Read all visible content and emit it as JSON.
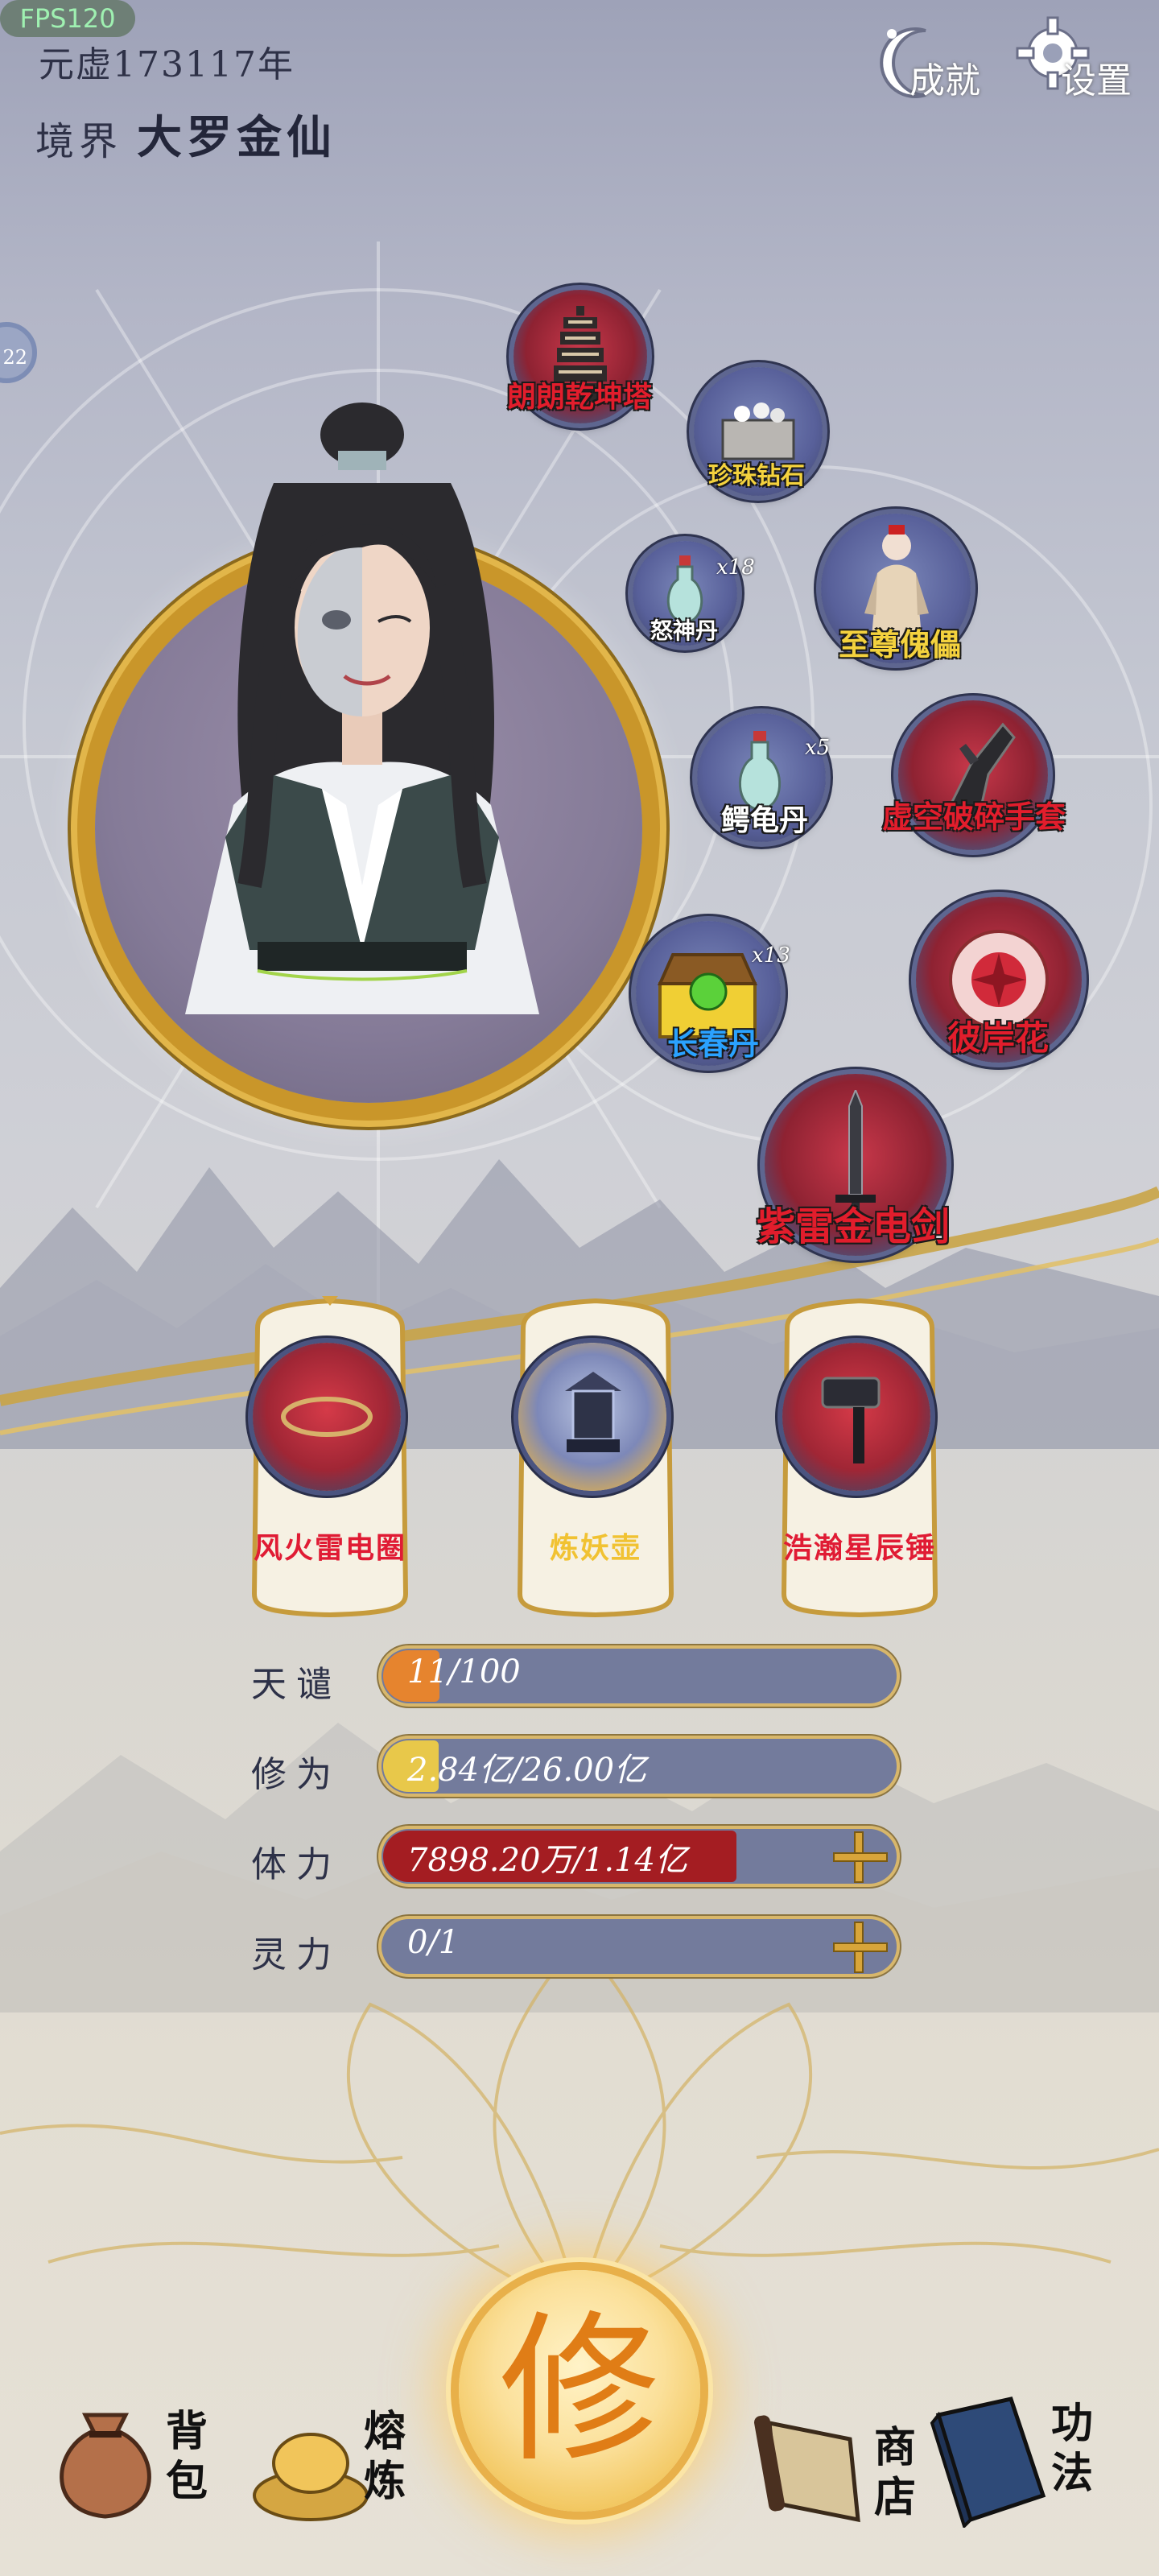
{
  "header": {
    "era": "元虚173117年",
    "realm_label": "境界",
    "realm_value": "大罗金仙",
    "fps": "FPS120",
    "achievements_label": "成就",
    "settings_label": "设置",
    "side_badge": "22"
  },
  "items": [
    {
      "name": "朗朗乾坤塔",
      "color": "red"
    },
    {
      "name": "珍珠钻石",
      "color": "gold"
    },
    {
      "name": "怒神丹",
      "color": "white",
      "count": "x18"
    },
    {
      "name": "至尊傀儡",
      "color": "gold"
    },
    {
      "name": "鳄龟丹",
      "color": "white",
      "count": "x5"
    },
    {
      "name": "虚空破碎手套",
      "color": "red"
    },
    {
      "name": "长春丹",
      "color": "blue",
      "count": "x13"
    },
    {
      "name": "彼岸花",
      "color": "red"
    },
    {
      "name": "紫雷金电剑",
      "color": "red"
    }
  ],
  "equipment": [
    {
      "name": "风火雷电圈"
    },
    {
      "name": "炼妖壶"
    },
    {
      "name": "浩瀚星辰锤"
    }
  ],
  "stats": [
    {
      "label": "天谴",
      "value": "11/100",
      "progress": 0.11,
      "color": "#e6842e"
    },
    {
      "label": "修为",
      "value": "2.84亿/26.00亿",
      "progress": 0.109,
      "color": "#e8c84a"
    },
    {
      "label": "体力",
      "value": "7898.20万/1.14亿",
      "progress": 0.69,
      "color": "#a41d22"
    },
    {
      "label": "灵力",
      "value": "0/1",
      "progress": 0,
      "color": "#7a83a8"
    }
  ],
  "nav": {
    "bag": "背包",
    "smelt": "熔炼",
    "cultivate": "修",
    "shop": "商店",
    "skills": "功法"
  },
  "colors": {
    "accent_gold": "#d8a53a",
    "item_red": "#e21d2c",
    "item_gold": "#f4d23e",
    "item_blue": "#2aa2ff"
  }
}
